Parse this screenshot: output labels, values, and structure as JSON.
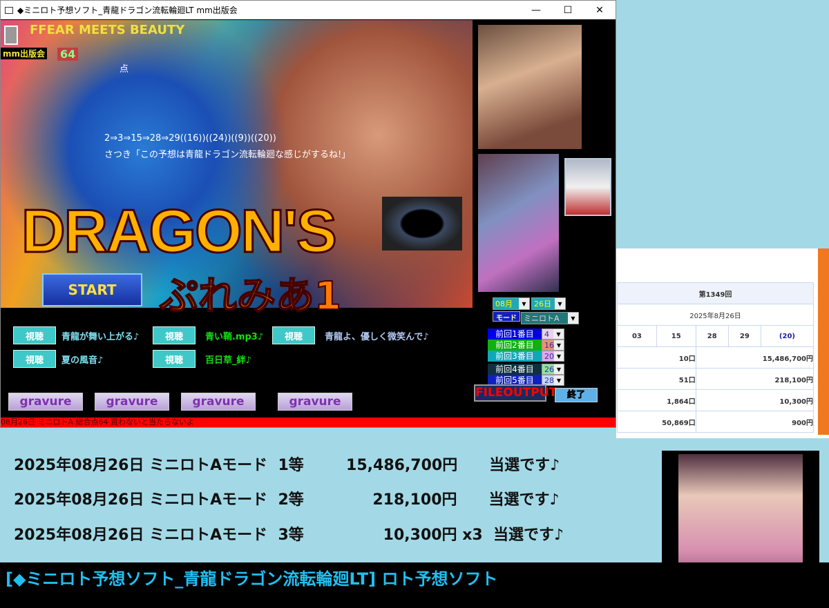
{
  "window": {
    "title": "◆ミニロト予想ソフト_青龍ドラゴン流転輪廻LT  mm出版会",
    "minimize": "—",
    "maximize": "☐",
    "close": "✕"
  },
  "hero": {
    "tagline": "FFEAR MEETS  BEAUTY",
    "publisher": "mm出版会",
    "score": "64",
    "score_unit": "点",
    "sequence": "2⇒3⇒15⇒28⇒29((16))((24))((9))((20))",
    "comment": "さつき「この予想は青龍ドラゴン流転輪廻な感じがするね!」",
    "logo_main": "DRAGON'S",
    "logo_sub": "ぷれみあ1",
    "start": "START"
  },
  "controls": {
    "month": "08月",
    "day": "26日",
    "mode_label": "モード",
    "mode": "ミニロトA",
    "previous": [
      {
        "label": "前回1番目",
        "value": "4",
        "color": "#0000e0",
        "vbg": "#e8d0f0"
      },
      {
        "label": "前回2番目",
        "value": "16",
        "color": "#10b010",
        "vbg": "#f09070"
      },
      {
        "label": "前回3番目",
        "value": "20",
        "color": "#10a8b8",
        "vbg": "#e0a8f0"
      },
      {
        "label": "前回4番目",
        "value": "26",
        "color": "#103040",
        "vbg": "#90e0a0"
      },
      {
        "label": "前回5番目",
        "value": "28",
        "color": "#1020c0",
        "vbg": "#c8d8f8"
      }
    ],
    "file_output": "FILEOUTPUT",
    "exit": "終了"
  },
  "songs": [
    {
      "button": "視聴",
      "title": "青龍が舞い上がる♪",
      "color": "#7fe0f0"
    },
    {
      "button": "視聴",
      "title": "青い鞘.mp3♪",
      "color": "#10e010"
    },
    {
      "button": "視聴",
      "title": "青龍よ、優しく微笑んで♪",
      "color": "#b0c8f0"
    },
    {
      "button": "視聴",
      "title": "夏の風音♪",
      "color": "#7fe0f0"
    },
    {
      "button": "視聴",
      "title": "百日草_絆♪",
      "color": "#10e010"
    }
  ],
  "gravure": [
    "gravure",
    "gravure",
    "gravure",
    "gravure"
  ],
  "status": "08月26日 ミニロトA  総合点64  買わないと当たらないよ",
  "table": {
    "round": "第1349回",
    "date": "2025年8月26日",
    "numbers": [
      "03",
      "15",
      "28",
      "29"
    ],
    "bonus": "(20)",
    "rows": [
      {
        "count": "10口",
        "prize": "15,486,700円"
      },
      {
        "count": "51口",
        "prize": "218,100円"
      },
      {
        "count": "1,864口",
        "prize": "10,300円"
      },
      {
        "count": "50,869口",
        "prize": "900円"
      }
    ]
  },
  "results": [
    "2025年08月26日 ミニロトAモード  1等        15,486,700円      当選です♪",
    "2025年08月26日 ミニロトAモード  2等             218,100円      当選です♪",
    "2025年08月26日 ミニロトAモード  3等               10,300円 x3  当選です♪"
  ],
  "footer": "[◆ミニロト予想ソフト_青龍ドラゴン流転輪廻LT] ロト予想ソフト"
}
